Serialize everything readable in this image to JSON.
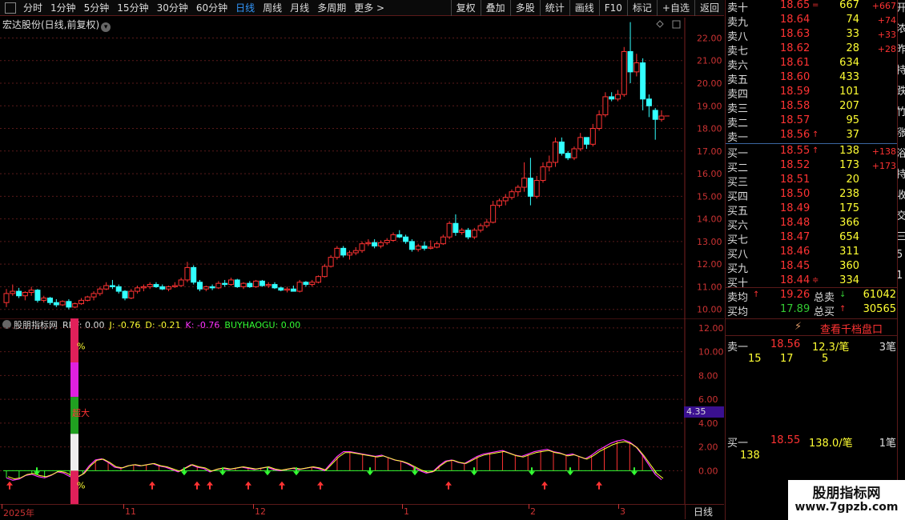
{
  "toolbar": {
    "periods": [
      "分时",
      "1分钟",
      "5分钟",
      "15分钟",
      "30分钟",
      "60分钟",
      "日线",
      "周线",
      "月线",
      "多周期",
      "更多 >"
    ],
    "active_period": "日线",
    "buttons": [
      "复权",
      "叠加",
      "多股",
      "统计",
      "画线",
      "F10",
      "标记",
      "+自选",
      "返回"
    ]
  },
  "stock": {
    "title": "宏达股份(日线,前复权)"
  },
  "price_axis": [
    "22.00",
    "21.00",
    "20.00",
    "19.00",
    "18.00",
    "17.00",
    "16.00",
    "15.00",
    "14.00",
    "13.00",
    "12.00",
    "11.00",
    "10.00"
  ],
  "indicator": {
    "name": "股朋指标网",
    "values": [
      {
        "label": "RRF: 0.00",
        "color": "#dddddd"
      },
      {
        "label": "J: -0.76",
        "color": "#ffff33"
      },
      {
        "label": "D: -0.21",
        "color": "#ffff33"
      },
      {
        "label": "K: -0.76",
        "color": "#ff33ff"
      },
      {
        "label": "BUYHAOGU: 0.00",
        "color": "#33ff33"
      }
    ],
    "axis": [
      "12.00",
      "10.00",
      "8.00",
      "6.00",
      "4.00",
      "2.00",
      "0.00"
    ],
    "current_tag": "4.35",
    "bar_top_label": "%",
    "bar_mid_label": "超大",
    "bar_bot_label": "%"
  },
  "date_axis": {
    "labels": [
      "2025年",
      "11",
      "12",
      "1",
      "2",
      "3"
    ],
    "period": "日线"
  },
  "order_book": {
    "sells": [
      {
        "label": "卖十",
        "price": "18.65",
        "arrow": "=",
        "vol": "667",
        "chg": "+667"
      },
      {
        "label": "卖九",
        "price": "18.64",
        "arrow": "",
        "vol": "74",
        "chg": "+74"
      },
      {
        "label": "卖八",
        "price": "18.63",
        "arrow": "",
        "vol": "33",
        "chg": "+33"
      },
      {
        "label": "卖七",
        "price": "18.62",
        "arrow": "",
        "vol": "28",
        "chg": "+28"
      },
      {
        "label": "卖六",
        "price": "18.61",
        "arrow": "",
        "vol": "634",
        "chg": ""
      },
      {
        "label": "卖五",
        "price": "18.60",
        "arrow": "",
        "vol": "433",
        "chg": ""
      },
      {
        "label": "卖四",
        "price": "18.59",
        "arrow": "",
        "vol": "101",
        "chg": ""
      },
      {
        "label": "卖三",
        "price": "18.58",
        "arrow": "",
        "vol": "207",
        "chg": ""
      },
      {
        "label": "卖二",
        "price": "18.57",
        "arrow": "",
        "vol": "95",
        "chg": ""
      },
      {
        "label": "卖一",
        "price": "18.56",
        "arrow": "↑",
        "vol": "37",
        "chg": ""
      }
    ],
    "buys": [
      {
        "label": "买一",
        "price": "18.55",
        "arrow": "↑",
        "vol": "138",
        "chg": "+138"
      },
      {
        "label": "买二",
        "price": "18.52",
        "arrow": "",
        "vol": "173",
        "chg": "+173"
      },
      {
        "label": "买三",
        "price": "18.51",
        "arrow": "",
        "vol": "20",
        "chg": ""
      },
      {
        "label": "买四",
        "price": "18.50",
        "arrow": "",
        "vol": "238",
        "chg": ""
      },
      {
        "label": "买五",
        "price": "18.49",
        "arrow": "",
        "vol": "175",
        "chg": ""
      },
      {
        "label": "买六",
        "price": "18.48",
        "arrow": "",
        "vol": "366",
        "chg": ""
      },
      {
        "label": "买七",
        "price": "18.47",
        "arrow": "",
        "vol": "654",
        "chg": ""
      },
      {
        "label": "买八",
        "price": "18.46",
        "arrow": "",
        "vol": "311",
        "chg": ""
      },
      {
        "label": "买九",
        "price": "18.45",
        "arrow": "",
        "vol": "360",
        "chg": ""
      },
      {
        "label": "买十",
        "price": "18.44",
        "arrow": "≑",
        "vol": "334",
        "chg": ""
      }
    ],
    "sell_avg": {
      "label": "卖均",
      "arrow": "↑",
      "price": "19.26",
      "total_label": "总卖",
      "total_arrow": "↓",
      "total": "61042"
    },
    "buy_avg": {
      "label": "买均",
      "arrow": "",
      "price": "17.89",
      "total_label": "总买",
      "total_arrow": "↑",
      "total": "30565"
    }
  },
  "thousand_link": "查看千档盘口",
  "queue": {
    "sell": {
      "label": "卖一",
      "price": "18.56",
      "detail": "12.3/笔",
      "count": "3笔",
      "orders": [
        "15",
        "17",
        "5"
      ]
    },
    "buy": {
      "label": "买一",
      "price": "18.55",
      "detail": "138.0/笔",
      "count": "1笔",
      "orders": [
        "138"
      ]
    }
  },
  "edge_chars": [
    "开",
    "浓",
    "昨",
    "持",
    "跌",
    "竹",
    "涨",
    "浴",
    "持",
    "收",
    "交",
    "三",
    "5",
    "1"
  ],
  "watermark": {
    "line1": "股朋指标网",
    "line2": "www.7gpzb.com"
  },
  "chart_data": {
    "type": "candlestick",
    "title": "宏达股份(日线,前复权)",
    "yrange": [
      9.6,
      22.9
    ],
    "candles": [
      [
        10.3,
        10.9,
        10.1,
        10.7
      ],
      [
        10.7,
        11.1,
        10.6,
        10.8
      ],
      [
        10.8,
        10.95,
        10.5,
        10.6
      ],
      [
        10.6,
        10.8,
        10.4,
        10.75
      ],
      [
        10.75,
        11.0,
        10.6,
        10.85
      ],
      [
        10.85,
        10.9,
        10.3,
        10.4
      ],
      [
        10.4,
        10.6,
        10.3,
        10.5
      ],
      [
        10.5,
        10.55,
        10.2,
        10.3
      ],
      [
        10.3,
        10.45,
        10.1,
        10.2
      ],
      [
        10.2,
        10.4,
        10.15,
        10.35
      ],
      [
        10.35,
        10.45,
        10.0,
        10.1
      ],
      [
        10.1,
        10.3,
        10.05,
        10.25
      ],
      [
        10.25,
        10.5,
        10.2,
        10.4
      ],
      [
        10.4,
        10.6,
        10.35,
        10.55
      ],
      [
        10.55,
        10.8,
        10.4,
        10.7
      ],
      [
        10.7,
        11.0,
        10.6,
        10.9
      ],
      [
        10.9,
        11.2,
        10.85,
        11.05
      ],
      [
        11.05,
        11.3,
        10.9,
        11.0
      ],
      [
        11.0,
        11.1,
        10.7,
        10.8
      ],
      [
        10.8,
        10.85,
        10.4,
        10.5
      ],
      [
        10.5,
        10.9,
        10.45,
        10.8
      ],
      [
        10.8,
        11.05,
        10.7,
        10.95
      ],
      [
        10.95,
        11.1,
        10.8,
        11.0
      ],
      [
        11.0,
        11.2,
        10.9,
        11.1
      ],
      [
        11.1,
        11.2,
        10.95,
        11.0
      ],
      [
        11.0,
        11.1,
        10.85,
        10.9
      ],
      [
        10.9,
        11.05,
        10.8,
        11.0
      ],
      [
        11.0,
        11.2,
        10.95,
        11.05
      ],
      [
        11.05,
        11.4,
        11.0,
        11.3
      ],
      [
        11.3,
        12.1,
        11.2,
        11.85
      ],
      [
        11.85,
        11.95,
        11.1,
        11.2
      ],
      [
        11.2,
        11.3,
        10.8,
        10.9
      ],
      [
        10.9,
        11.05,
        10.8,
        11.0
      ],
      [
        11.0,
        11.1,
        10.85,
        10.95
      ],
      [
        10.95,
        11.25,
        10.9,
        11.15
      ],
      [
        11.15,
        11.3,
        11.0,
        11.1
      ],
      [
        11.1,
        11.4,
        11.05,
        11.3
      ],
      [
        11.3,
        11.35,
        10.95,
        11.0
      ],
      [
        11.0,
        11.2,
        10.9,
        11.15
      ],
      [
        11.15,
        11.25,
        10.95,
        11.0
      ],
      [
        11.0,
        11.3,
        10.95,
        11.25
      ],
      [
        11.25,
        11.3,
        11.0,
        11.05
      ],
      [
        11.05,
        11.2,
        10.95,
        11.1
      ],
      [
        11.1,
        11.2,
        10.9,
        10.95
      ],
      [
        10.95,
        11.0,
        10.8,
        10.85
      ],
      [
        10.85,
        11.0,
        10.75,
        10.9
      ],
      [
        10.9,
        11.05,
        10.8,
        10.8
      ],
      [
        10.8,
        11.3,
        10.75,
        11.2
      ],
      [
        11.2,
        11.25,
        11.0,
        11.1
      ],
      [
        11.1,
        11.3,
        11.0,
        11.2
      ],
      [
        11.2,
        11.5,
        11.15,
        11.45
      ],
      [
        11.45,
        12.0,
        11.4,
        11.9
      ],
      [
        11.9,
        12.4,
        11.85,
        12.3
      ],
      [
        12.3,
        12.8,
        12.2,
        12.7
      ],
      [
        12.7,
        12.8,
        12.3,
        12.4
      ],
      [
        12.4,
        12.6,
        12.2,
        12.5
      ],
      [
        12.5,
        12.75,
        12.4,
        12.6
      ],
      [
        12.6,
        13.0,
        12.5,
        12.9
      ],
      [
        12.9,
        13.1,
        12.8,
        12.95
      ],
      [
        12.95,
        13.1,
        12.7,
        12.8
      ],
      [
        12.8,
        13.05,
        12.7,
        12.95
      ],
      [
        12.95,
        13.15,
        12.85,
        13.05
      ],
      [
        13.05,
        13.4,
        13.0,
        13.3
      ],
      [
        13.3,
        13.5,
        13.15,
        13.2
      ],
      [
        13.2,
        13.3,
        12.9,
        13.0
      ],
      [
        13.0,
        13.1,
        12.55,
        12.65
      ],
      [
        12.65,
        12.9,
        12.55,
        12.8
      ],
      [
        12.8,
        13.0,
        12.6,
        12.7
      ],
      [
        12.7,
        13.05,
        12.65,
        12.75
      ],
      [
        12.75,
        13.0,
        12.7,
        12.9
      ],
      [
        12.9,
        13.3,
        12.85,
        13.2
      ],
      [
        13.2,
        13.9,
        13.1,
        13.8
      ],
      [
        13.8,
        14.2,
        13.25,
        13.4
      ],
      [
        13.4,
        13.6,
        13.3,
        13.5
      ],
      [
        13.5,
        13.6,
        13.1,
        13.2
      ],
      [
        13.2,
        13.6,
        13.1,
        13.5
      ],
      [
        13.5,
        13.8,
        13.4,
        13.7
      ],
      [
        13.7,
        14.0,
        13.6,
        13.85
      ],
      [
        13.85,
        14.8,
        13.8,
        14.6
      ],
      [
        14.6,
        14.9,
        14.5,
        14.8
      ],
      [
        14.8,
        15.1,
        14.6,
        14.95
      ],
      [
        14.95,
        15.3,
        14.85,
        15.2
      ],
      [
        15.2,
        15.5,
        15.0,
        15.4
      ],
      [
        15.4,
        16.5,
        15.2,
        15.8
      ],
      [
        15.8,
        16.7,
        14.6,
        15.0
      ],
      [
        15.0,
        15.9,
        14.9,
        15.7
      ],
      [
        15.7,
        16.5,
        15.6,
        16.3
      ],
      [
        16.3,
        16.8,
        16.1,
        16.5
      ],
      [
        16.5,
        17.6,
        16.3,
        17.4
      ],
      [
        17.4,
        17.6,
        16.8,
        16.9
      ],
      [
        16.9,
        17.0,
        16.6,
        16.7
      ],
      [
        16.7,
        17.2,
        16.6,
        17.1
      ],
      [
        17.1,
        17.8,
        17.0,
        17.6
      ],
      [
        17.6,
        17.5,
        17.1,
        17.3
      ],
      [
        17.3,
        18.2,
        17.2,
        18.0
      ],
      [
        18.0,
        18.8,
        17.9,
        18.6
      ],
      [
        18.6,
        19.6,
        18.5,
        19.4
      ],
      [
        19.4,
        19.6,
        19.2,
        19.3
      ],
      [
        19.3,
        19.7,
        19.2,
        19.5
      ],
      [
        19.5,
        21.6,
        19.4,
        21.4
      ],
      [
        21.4,
        22.7,
        20.0,
        20.5
      ],
      [
        20.5,
        21.3,
        20.3,
        20.9
      ],
      [
        20.9,
        21.1,
        18.8,
        19.3
      ],
      [
        19.3,
        19.5,
        18.5,
        19.0
      ],
      [
        18.8,
        18.9,
        17.5,
        18.4
      ],
      [
        18.4,
        18.8,
        18.3,
        18.55
      ]
    ],
    "indicator_series": {
      "lines": [
        "K",
        "D",
        "J"
      ],
      "axis_range": [
        -2.8,
        12.8
      ]
    }
  }
}
